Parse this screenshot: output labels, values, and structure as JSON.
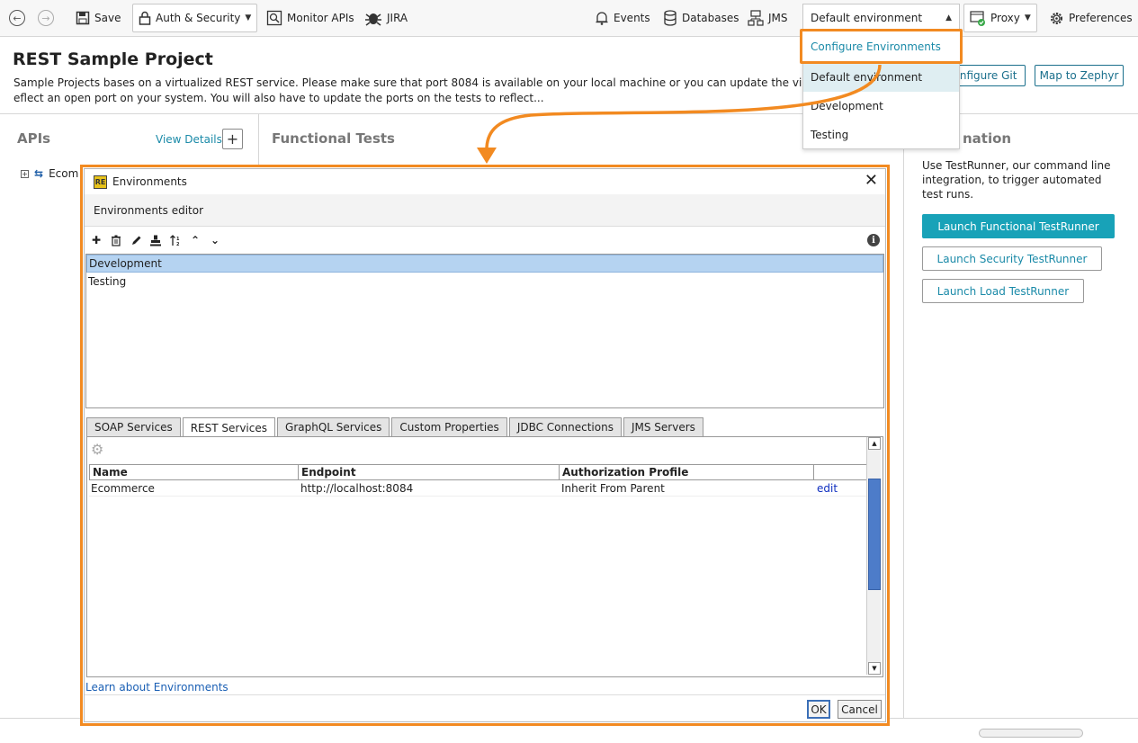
{
  "toolbar": {
    "save_label": "Save",
    "auth_label": "Auth & Security",
    "monitor_label": "Monitor APIs",
    "jira_label": "JIRA",
    "events_label": "Events",
    "databases_label": "Databases",
    "jms_label": "JMS",
    "environment_selected": "Default environment",
    "proxy_label": "Proxy",
    "preferences_label": "Preferences"
  },
  "env_menu": {
    "items": [
      "Configure Environments",
      "Default environment",
      "Development",
      "Testing"
    ]
  },
  "header": {
    "title": "REST Sample Project",
    "description_line1": "Sample Projects bases on a virtualized REST service. Please make sure that port 8084 is available on your local machine or you can update the virtual API unde",
    "description_line2": "eflect an open port on your system. You will also have to update the ports on the tests to reflect...",
    "configure_git_label": "onfigure Git",
    "map_zephyr_label": "Map to Zephyr"
  },
  "apis_panel": {
    "title": "APIs",
    "view_details": "View Details",
    "add_label": "+",
    "tree_item": "Ecom"
  },
  "functional_panel": {
    "title": "Functional Tests"
  },
  "automation_panel": {
    "title": "nation",
    "text": "Use TestRunner, our command line integration, to trigger automated test runs.",
    "buttons": [
      "Launch Functional TestRunner",
      "Launch Security TestRunner",
      "Launch Load TestRunner"
    ]
  },
  "dialog": {
    "title": "Environments",
    "subtitle": "Environments editor",
    "environments": [
      "Development",
      "Testing"
    ],
    "tabs": [
      "SOAP Services",
      "REST Services",
      "GraphQL Services",
      "Custom Properties",
      "JDBC Connections",
      "JMS Servers"
    ],
    "active_tab": "REST Services",
    "columns": [
      "Name",
      "Endpoint",
      "Authorization Profile",
      ""
    ],
    "rows": [
      {
        "name": "Ecommerce",
        "endpoint": "http://localhost:8084",
        "auth": "Inherit From Parent",
        "action": "edit"
      }
    ],
    "learn_link": "Learn about Environments",
    "ok_label": "OK",
    "cancel_label": "Cancel"
  },
  "colors": {
    "highlight": "#f28a21",
    "accent": "#18a2b8",
    "selection": "#b5d3f1"
  }
}
